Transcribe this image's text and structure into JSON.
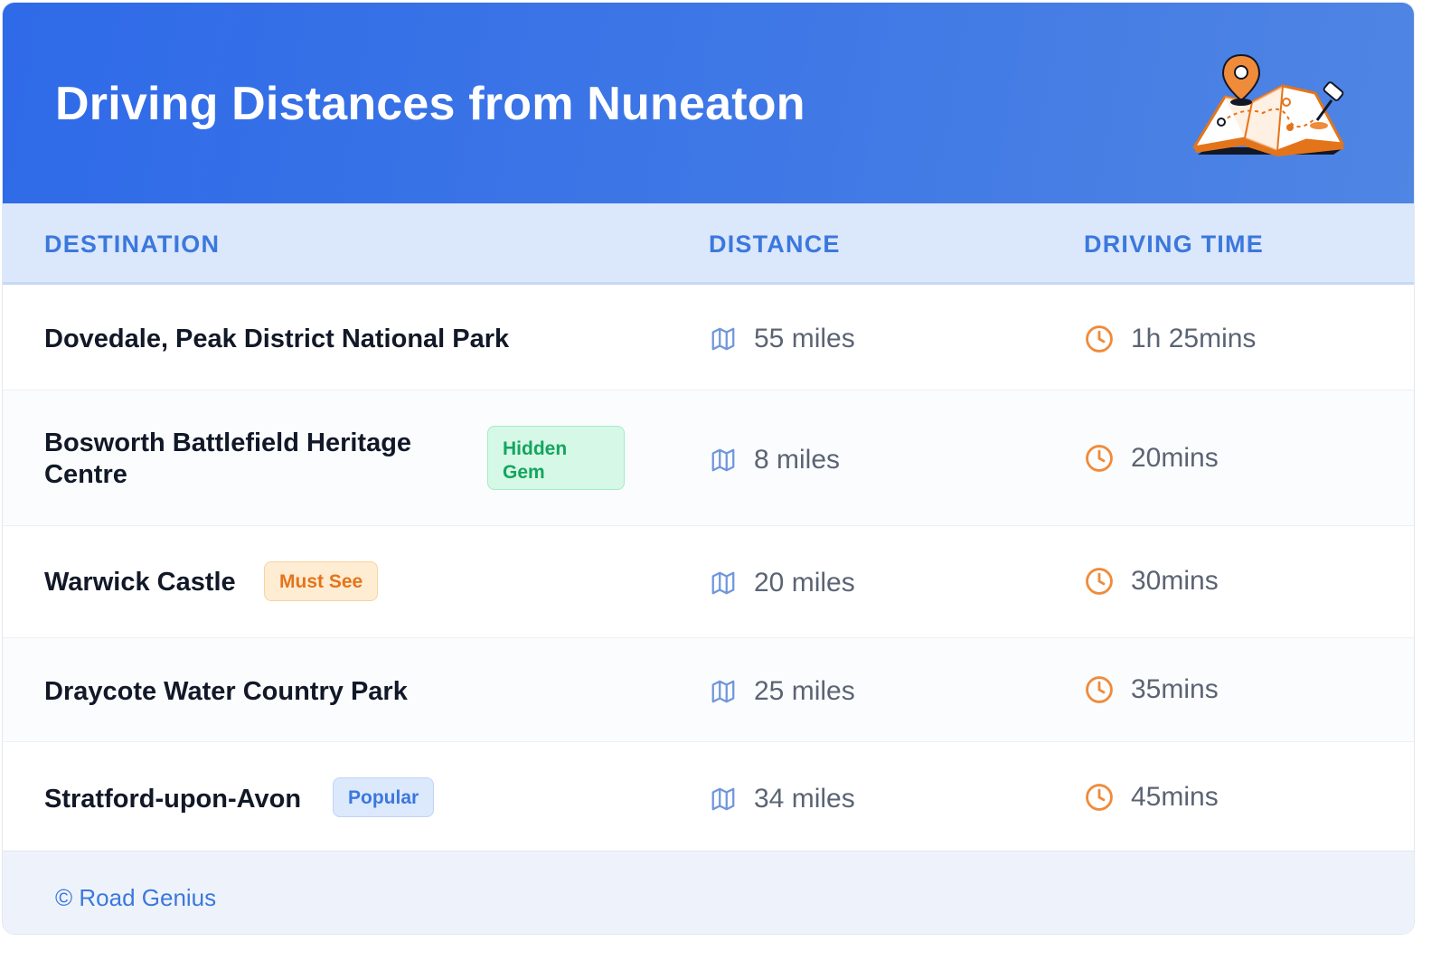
{
  "header": {
    "title": "Driving Distances from Nuneaton",
    "illustration_icon": "map-with-pins-icon"
  },
  "table": {
    "columns": [
      "DESTINATION",
      "DISTANCE",
      "DRIVING TIME"
    ],
    "rows": [
      {
        "destination": "Dovedale, Peak District National Park",
        "badge": "",
        "distance": "55 miles",
        "time": "1h 25mins"
      },
      {
        "destination": "Bosworth Battlefield Heritage Centre",
        "badge": "Hidden Gem",
        "distance": "8 miles",
        "time": "20mins"
      },
      {
        "destination": "Warwick Castle",
        "badge": "Must See",
        "distance": "20 miles",
        "time": "30mins"
      },
      {
        "destination": "Draycote Water Country Park",
        "badge": "",
        "distance": "25 miles",
        "time": "35mins"
      },
      {
        "destination": "Stratford-upon-Avon",
        "badge": "Popular",
        "distance": "34 miles",
        "time": "45mins"
      }
    ]
  },
  "footer": {
    "text": "© Road Genius"
  },
  "colors": {
    "header_start": "#2f6ae8",
    "header_end": "#4f85e3",
    "accent_blue": "#3b78dd",
    "clock_orange": "#f08b3a",
    "map_icon_blue": "#6f96dc",
    "hidden_gem_green": "#14a55f",
    "must_see_orange": "#e4741a"
  }
}
